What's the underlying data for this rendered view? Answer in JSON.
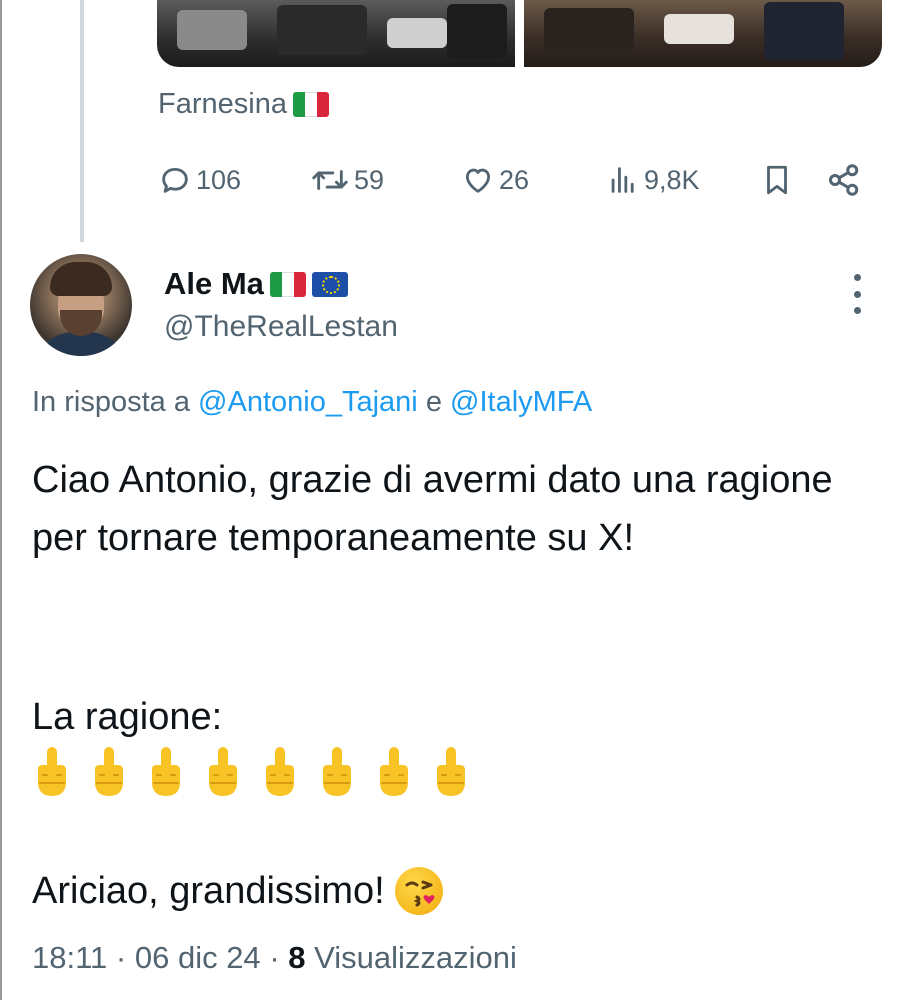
{
  "parent_tweet": {
    "source_label": "Farnesina",
    "stats": {
      "replies": "106",
      "retweets": "59",
      "likes": "26",
      "views": "9,8K"
    }
  },
  "reply_tweet": {
    "author_name": "Ale Ma",
    "author_handle": "@TheRealLestan",
    "reply_prefix": "In risposta a",
    "reply_mention_1": "@Antonio_Tajani",
    "reply_joiner": "e",
    "reply_mention_2": "@ItalyMFA",
    "text_paragraph_1": "Ciao Antonio, grazie di avermi dato una ragione per tornare temporaneamente su X!",
    "text_paragraph_2": "La ragione:",
    "emoji_count": 8,
    "text_closing": "Ariciao, grandissimo!",
    "time": "18:11",
    "date": "06 dic 24",
    "views_count": "8",
    "views_label": "Visualizzazioni"
  },
  "colors": {
    "text_primary": "#0f1419",
    "text_secondary": "#536471",
    "accent_blue": "#1d9bf0",
    "thread_line": "#cfd9de"
  },
  "icons": {
    "reply": "reply-icon",
    "retweet": "retweet-icon",
    "like": "heart-icon",
    "views": "views-icon",
    "bookmark": "bookmark-icon",
    "share": "share-icon",
    "more": "more-icon",
    "flag_italy": "italy-flag-icon",
    "flag_eu": "eu-flag-icon",
    "middle_finger": "middle-finger-emoji",
    "kiss": "kissing-face-emoji"
  }
}
